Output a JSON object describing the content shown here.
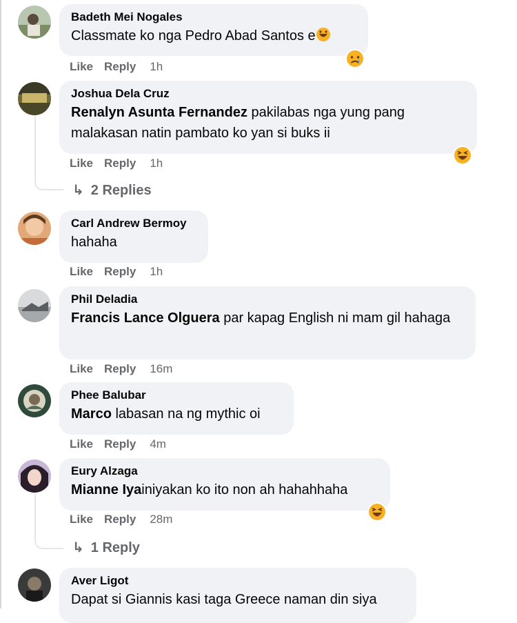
{
  "comments": [
    {
      "author": "Badeth Mei Nogales",
      "mention": "",
      "text": "Classmate ko nga Pedro Abad Santos e",
      "time": "1h"
    },
    {
      "author": "Joshua Dela Cruz",
      "mention": "Renalyn Asunta Fernandez",
      "text": " pakilabas nga yung pang malakasan natin pambato ko yan si buks ii",
      "time": "1h"
    },
    {
      "author": "Carl Andrew Bermoy",
      "mention": "",
      "text": "hahaha",
      "time": "1h"
    },
    {
      "author": "Phil Deladia",
      "mention": "Francis Lance Olguera",
      "text": " par kapag English ni mam gil hahaga",
      "time": "16m"
    },
    {
      "author": "Phee Balubar",
      "mention": "Marco",
      "text": " labasan na ng mythic oi",
      "time": "4m"
    },
    {
      "author": "Eury Alzaga",
      "mention": "Mianne Iya",
      "text": "iniyakan ko ito non ah hahahhaha",
      "time": "28m"
    },
    {
      "author": "Aver Ligot",
      "mention": "",
      "text": "Dapat si Giannis kasi taga Greece naman din siya",
      "time": ""
    }
  ],
  "actions": {
    "like": "Like",
    "reply": "Reply"
  },
  "replies": {
    "joshua": "2 Replies",
    "eury": "1 Reply"
  },
  "colors": {
    "bubble": "#f0f2f5",
    "meta": "#65676b",
    "text": "#050505",
    "reaction": "#f7b125"
  },
  "icons": {
    "reply_arrow": "reply-arrow-icon",
    "reactions": [
      "laugh-reaction-icon",
      "sad-reaction-icon"
    ]
  }
}
